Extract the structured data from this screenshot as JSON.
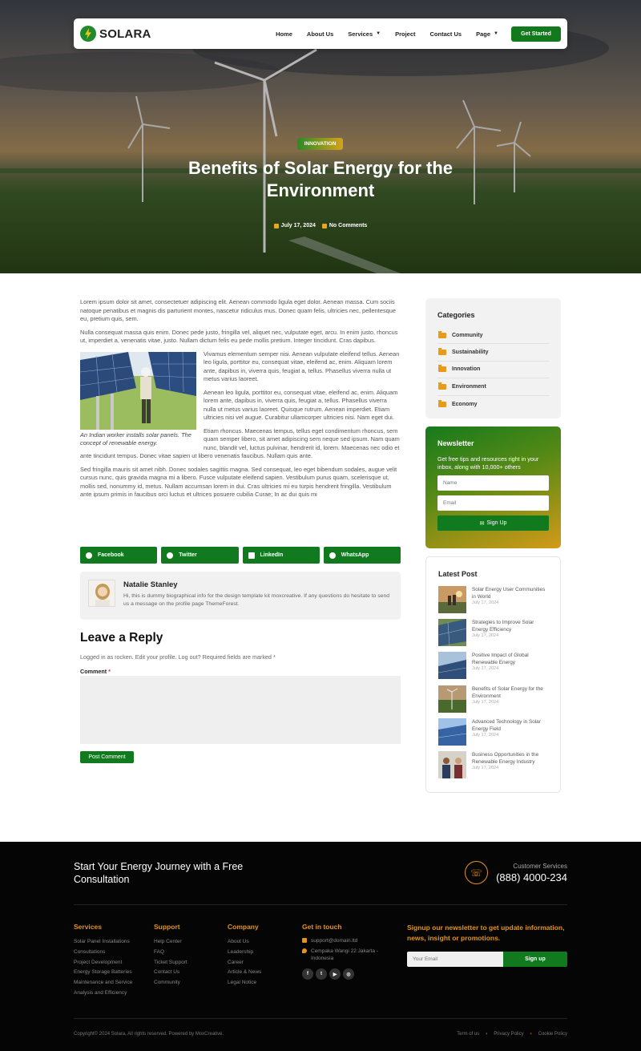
{
  "brand": {
    "name": "SOLARA"
  },
  "nav": {
    "items": [
      {
        "label": "Home",
        "dropdown": false
      },
      {
        "label": "About Us",
        "dropdown": false
      },
      {
        "label": "Services",
        "dropdown": true
      },
      {
        "label": "Project",
        "dropdown": false
      },
      {
        "label": "Contact Us",
        "dropdown": false
      },
      {
        "label": "Page",
        "dropdown": true
      }
    ],
    "cta": "Get Started"
  },
  "hero": {
    "category": "INNOVATION",
    "title": "Benefits of Solar Energy for the Environment",
    "date": "July 17, 2024",
    "comments": "No Comments"
  },
  "article": {
    "p1": "Lorem ipsum dolor sit amet, consectetuer adipiscing elit. Aenean commodo ligula eget dolor. Aenean massa. Cum sociis natoque penatibus et magnis dis parturient montes, nascetur ridiculus mus. Donec quam felis, ultricies nec, pellentesque eu, pretium quis, sem.",
    "p2": "Nulla consequat massa quis enim. Donec pede justo, fringilla vel, aliquet nec, vulputate eget, arcu. In enim justo, rhoncus ut, imperdiet a, venenatis vitae, justo. Nullam dictum felis eu pede mollis pretium. Integer tincidunt. Cras dapibus.",
    "caption": "An Indian worker installs solar panels. The concept of renewable energy.",
    "p3": "Vivamus elementum semper nisi. Aenean vulputate eleifend tellus. Aenean leo ligula, porttitor eu, consequat vitae, eleifend ac, enim. Aliquam lorem ante, dapibus in, viverra quis, feugiat a, tellus. Phasellus viverra nulla ut metus varius laoreet.",
    "p4": "Aenean leo ligula, porttitor eu, consequat vitae, eleifend ac, enim. Aliquam lorem ante, dapibus in, viverra quis, feugiat a, tellus. Phasellus viverra nulla ut metus varius laoreet. Quisque rutrum. Aenean imperdiet. Etiam ultricies nisi vel augue. Curabitur ullamcorper ultricies nisi. Nam eget dui.",
    "p5": "Etiam rhoncus. Maecenas tempus, tellus eget condimentum rhoncus, sem quam semper libero, sit amet adipiscing sem neque sed ipsum. Nam quam nunc, blandit vel, luctus pulvinar, hendrerit id, lorem. Maecenas nec odio et ante tincidunt tempus. Donec vitae sapien ut libero venenatis faucibus. Nullam quis ante.",
    "p6": "Sed fringilla mauris sit amet nibh. Donec sodales sagittis magna. Sed consequat, leo eget bibendum sodales, augue velit cursus nunc, quis gravida magna mi a libero. Fusce vulputate eleifend sapien. Vestibulum purus quam, scelerisque ut, mollis sed, nonummy id, metus. Nullam accumsan lorem in dui. Cras ultricies mi eu turpis hendrerit fringilla. Vestibulum ante ipsum primis in faucibus orci luctus et ultrices posuere cubilia Curae; In ac dui quis mi"
  },
  "share": [
    {
      "label": "Facebook",
      "icon": "facebook-icon"
    },
    {
      "label": "Twitter",
      "icon": "twitter-icon"
    },
    {
      "label": "LinkedIn",
      "icon": "linkedin-icon"
    },
    {
      "label": "WhatsApp",
      "icon": "whatsapp-icon"
    }
  ],
  "author": {
    "name": "Natalie Stanley",
    "bio": "Hi, this is dummy biographical info for the design template kit moxcreative. If any questions do hesitate to send us a message on the profile page ThemeForest."
  },
  "reply": {
    "title": "Leave a Reply",
    "logged_in": "Logged in as rocken. Edit your profile. Log out? Required fields are marked",
    "required_mark": "*",
    "comment_label": "Comment",
    "submit": "Post Comment"
  },
  "sidebar": {
    "categories_title": "Categories",
    "categories": [
      "Community",
      "Sustainability",
      "Innovation",
      "Environment",
      "Economy"
    ],
    "newsletter": {
      "title": "Newsletter",
      "desc": "Get free tips and resources right in your inbox, along with 10,000+ others",
      "name_placeholder": "Name",
      "email_placeholder": "Email",
      "button": "Sign Up"
    },
    "latest_title": "Latest Post",
    "latest": [
      {
        "title": "Solar Energy User Communities in World",
        "date": "July 17, 2024"
      },
      {
        "title": "Strategies to Improve Solar Energy Efficiency",
        "date": "July 17, 2024"
      },
      {
        "title": "Positive Impact of Global Renewable Energy",
        "date": "July 17, 2024"
      },
      {
        "title": "Benefits of Solar Energy for the Environment",
        "date": "July 17, 2024"
      },
      {
        "title": "Advanced Technology in Solar Energy Field",
        "date": "July 17, 2024"
      },
      {
        "title": "Business Opportunities in the Renewable Energy Industry",
        "date": "July 17, 2024"
      }
    ]
  },
  "footer": {
    "cta": "Start Your Energy Journey with a Free Consultation",
    "cs_label": "Customer Services",
    "phone": "(888) 4000-234",
    "services": {
      "title": "Services",
      "links": [
        "Solar Panel Installations",
        "Consultations",
        "Project Development",
        "Energy Storage Batteries",
        "Maintenance and Service",
        "Analysis and Efficiency"
      ]
    },
    "support": {
      "title": "Support",
      "links": [
        "Help Center",
        "FAQ",
        "Ticket Support",
        "Contact Us",
        "Community"
      ]
    },
    "company": {
      "title": "Company",
      "links": [
        "About Us",
        "Leadership",
        "Career",
        "Article & News",
        "Legal Notice"
      ]
    },
    "contact": {
      "title": "Get in touch",
      "email": "support@domain.ltd",
      "address": "Cempaka Wangi 22 Jakarta - Indonesia"
    },
    "newsletter_title": "Signup our newsletter to get update information, news, insight or promotions.",
    "email_placeholder": "Your Email",
    "signup": "Sign up",
    "copyright": "Copyright© 2024 Solara, All rights reserved. Powered by MoxCreative.",
    "legal": [
      "Term of us",
      "Privacy Policy",
      "Cookie Policy"
    ]
  },
  "colors": {
    "primary": "#117a1f",
    "accent": "#e3941a",
    "footer_bg": "#050505"
  }
}
